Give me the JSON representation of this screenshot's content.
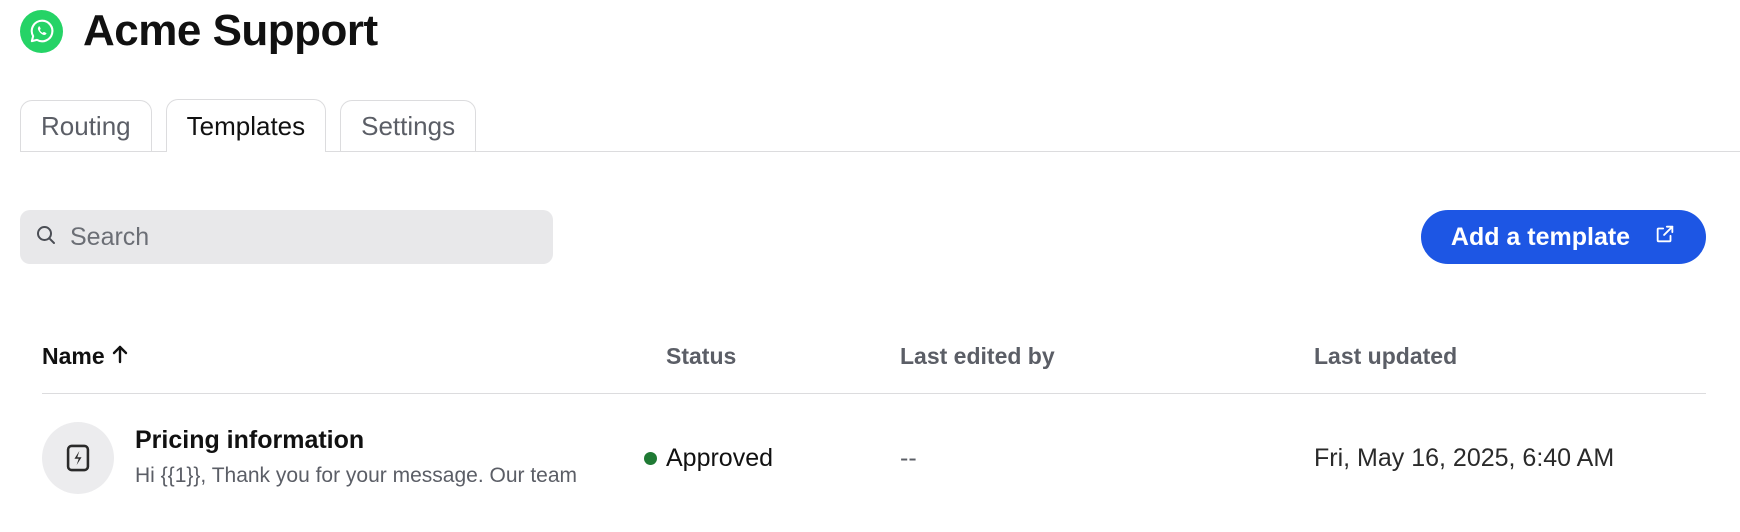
{
  "app": {
    "title": "Acme Support",
    "brand_color": "#25d366",
    "logo_icon": "whatsapp-icon"
  },
  "tabs": [
    {
      "label": "Routing",
      "active": false
    },
    {
      "label": "Templates",
      "active": true
    },
    {
      "label": "Settings",
      "active": false
    }
  ],
  "search": {
    "placeholder": "Search",
    "value": ""
  },
  "add_button": {
    "label": "Add a template",
    "icon": "external-link-icon",
    "color": "#1d56e4"
  },
  "table": {
    "columns": {
      "name": "Name",
      "name_sort_icon": "arrow-up-icon",
      "status": "Status",
      "last_edited_by": "Last edited by",
      "last_updated": "Last updated"
    },
    "rows": [
      {
        "icon": "lightning-document-icon",
        "name": "Pricing information",
        "preview": "Hi {{1}}, Thank you for your message. Our team",
        "status": "Approved",
        "status_color": "#1f7a34",
        "last_edited_by": "--",
        "last_updated": "Fri, May 16, 2025, 6:40 AM"
      }
    ]
  }
}
